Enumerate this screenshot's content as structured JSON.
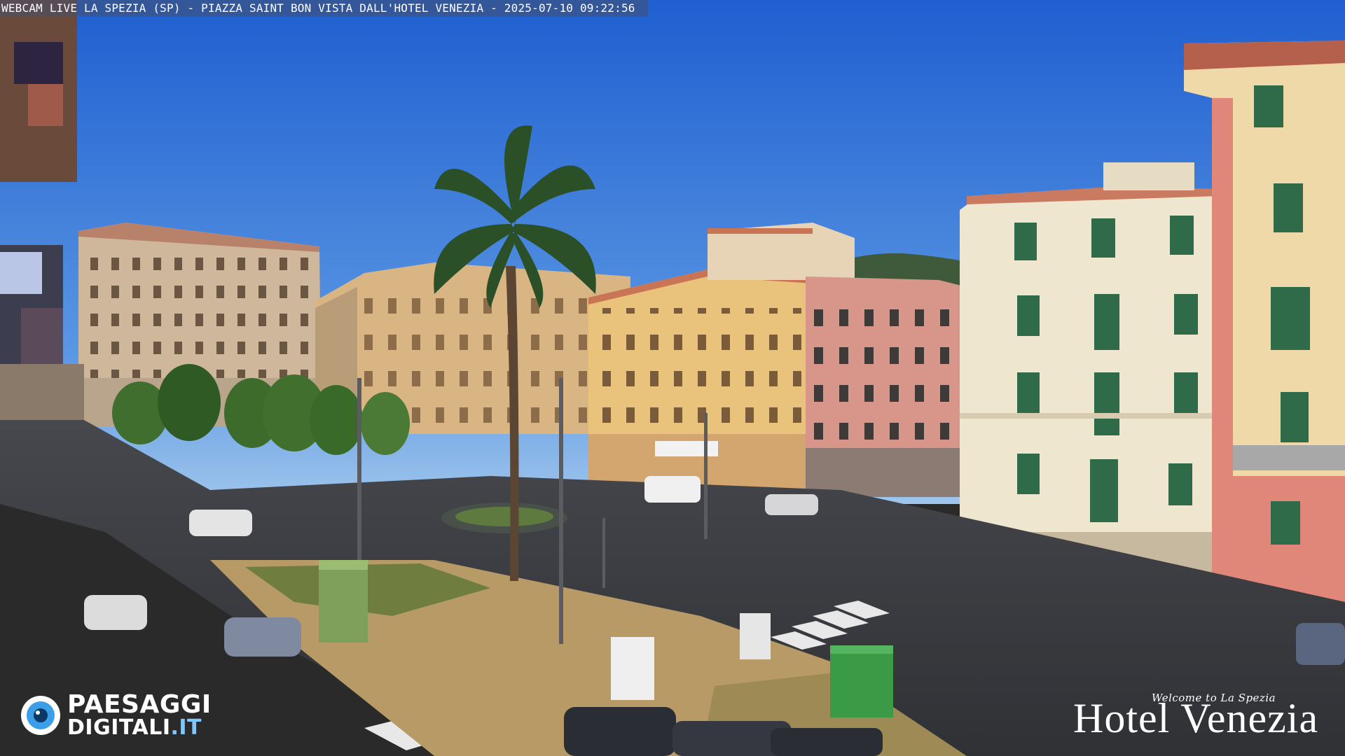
{
  "overlay": {
    "caption": "WEBCAM LIVE LA SPEZIA (SP) - PIAZZA SAINT BON VISTA DALL'HOTEL VENEZIA - 2025-07-10 09:22:56"
  },
  "logo": {
    "line1": "PAESAGGI",
    "line2": "DIGITALI",
    "line2_suffix": ".IT",
    "icon": "camera-lens-icon",
    "accent_color": "#3a9ee8"
  },
  "hotel_brand": {
    "tagline": "Welcome to La Spezia",
    "name": "Hotel Venezia"
  },
  "colors": {
    "sky_top": "#1f5fd0",
    "sky_bottom": "#8fbcea",
    "building_ochre": "#e9c37c",
    "building_pink": "#d8968a",
    "building_cream": "#efe6cf",
    "building_red": "#e1877a",
    "shutter_green": "#2f6b48",
    "asphalt": "#3d3f44"
  }
}
